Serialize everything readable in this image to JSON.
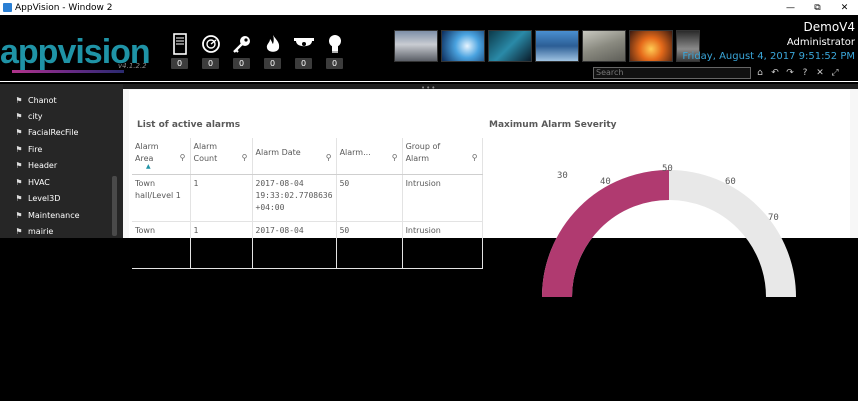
{
  "window": {
    "title": "AppVision - Window 2",
    "controls": [
      "—",
      "⧉",
      "✕"
    ]
  },
  "header": {
    "logo": "appvision",
    "version": "v4.1.2.2",
    "counters": [
      {
        "icon": "server-icon",
        "value": "0"
      },
      {
        "icon": "alarm-dial-icon",
        "value": "0"
      },
      {
        "icon": "key-icon",
        "value": "0"
      },
      {
        "icon": "fire-icon",
        "value": "0"
      },
      {
        "icon": "camera-icon",
        "value": "0"
      },
      {
        "icon": "bulb-icon",
        "value": "0"
      }
    ],
    "server_name": "DemoV4",
    "user_name": "Administrator",
    "datetime": "Friday, August 4, 2017 9:51:52 PM",
    "search_placeholder": "Search",
    "toolbar_icons": [
      "home-icon",
      "undo-icon",
      "redo-icon",
      "help-icon",
      "tools-icon",
      "expand-icon"
    ],
    "colors": {
      "accent": "#1f93a6",
      "datetime": "#3aa6d9",
      "magenta": "#b0338a"
    }
  },
  "sidebar": {
    "items": [
      {
        "label": "Chanot"
      },
      {
        "label": "city"
      },
      {
        "label": "FacialRecFile"
      },
      {
        "label": "Fire"
      },
      {
        "label": "Header"
      },
      {
        "label": "HVAC"
      },
      {
        "label": "Level3D"
      },
      {
        "label": "Maintenance"
      },
      {
        "label": "mairie"
      }
    ]
  },
  "main": {
    "grip": "•••",
    "alarms_title": "List of active alarms",
    "severity_title": "Maximum Alarm Severity",
    "table": {
      "columns": [
        {
          "label": "Alarm Area"
        },
        {
          "label": "Alarm Count"
        },
        {
          "label": "Alarm Date"
        },
        {
          "label": "Alarm..."
        },
        {
          "label": "Group of Alarm"
        }
      ],
      "rows": [
        [
          "Town hall/Level 1",
          "1",
          "2017-08-04 19:33:02.7708636 +04:00",
          "50",
          "Intrusion"
        ],
        [
          "Town",
          "1",
          "2017-08-04",
          "50",
          "Intrusion"
        ]
      ]
    },
    "gauge": {
      "value": 50,
      "fill_color": "#b03a70",
      "track_color": "#e8e8e8",
      "labels": [
        "30",
        "40",
        "50",
        "60",
        "70"
      ]
    }
  }
}
